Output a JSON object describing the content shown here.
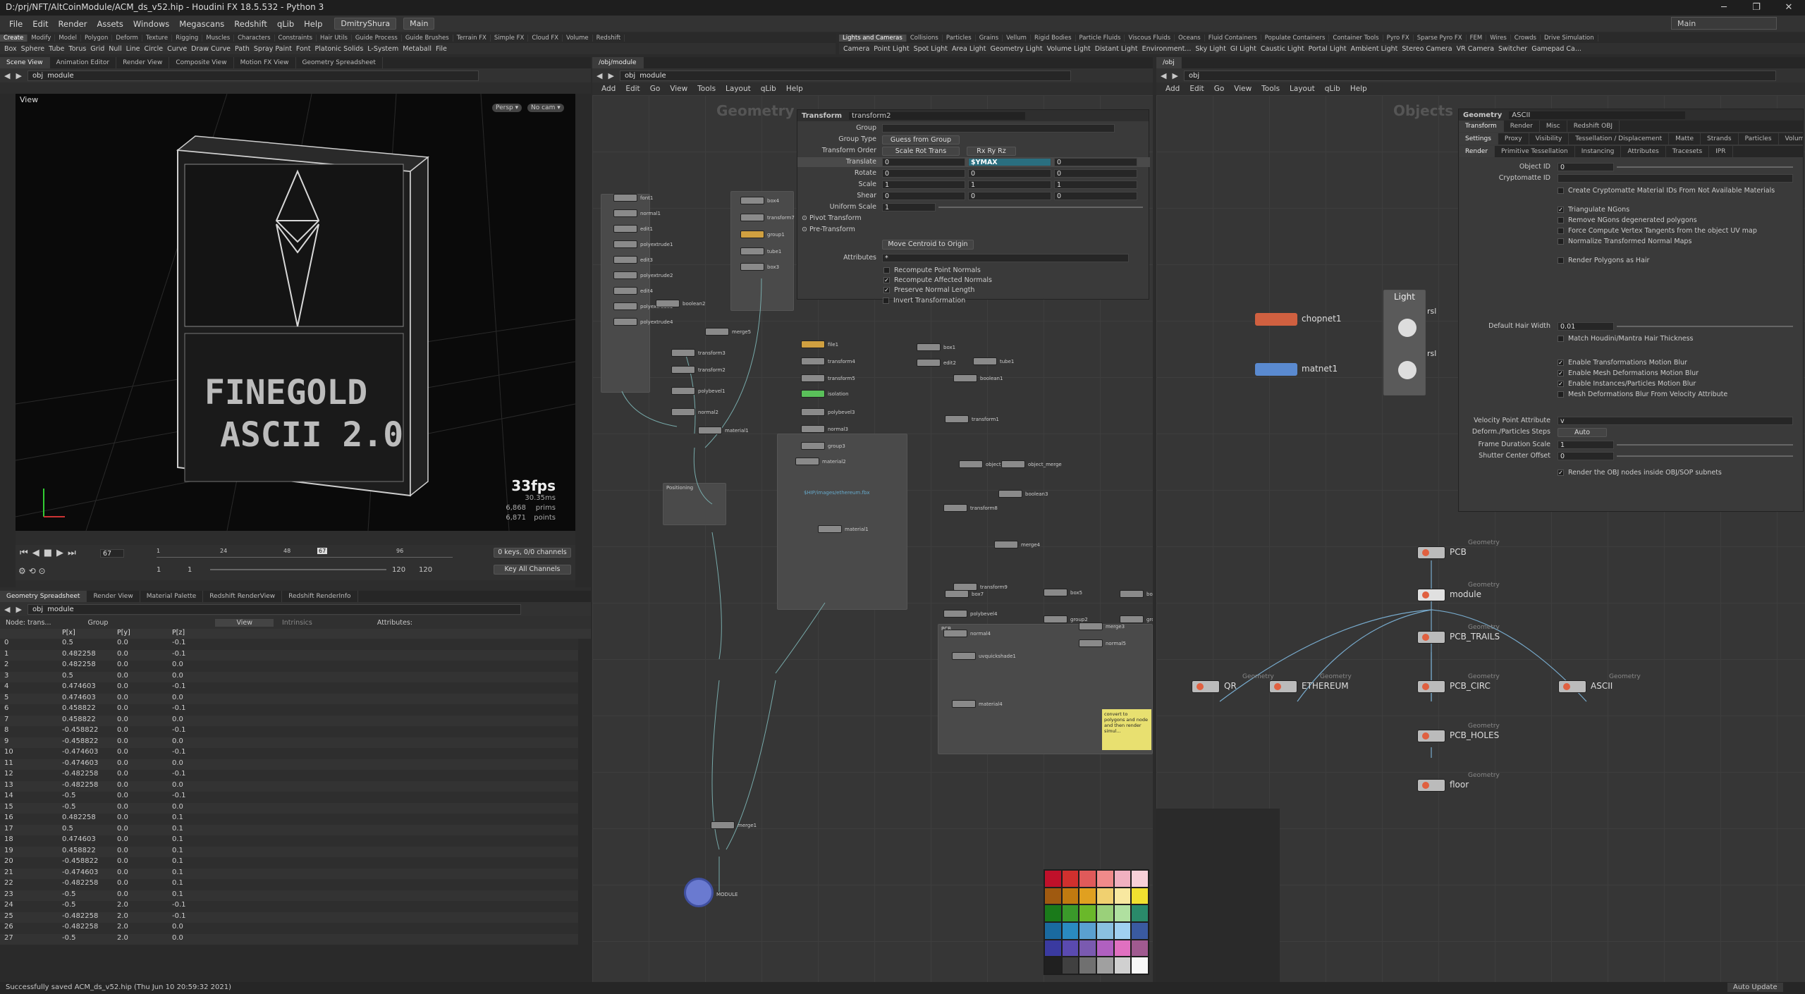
{
  "window": {
    "title": "D:/prj/NFT/AltCoinModule/ACM_ds_v52.hip - Houdini FX 18.5.532 - Python 3",
    "btn_min": "─",
    "btn_max": "❐",
    "btn_close": "✕"
  },
  "menu": {
    "items": [
      "File",
      "Edit",
      "Render",
      "Assets",
      "Windows",
      "Megascans",
      "Redshift",
      "qLib",
      "Help"
    ],
    "user": "DmitryShura",
    "desktop": "Main",
    "right_desktop": "Main"
  },
  "shelf_left": {
    "tabs": [
      "Create",
      "Modify",
      "Model",
      "Polygon",
      "Deform",
      "Texture",
      "Rigging",
      "Muscles",
      "Characters",
      "Constraints",
      "Hair Utils",
      "Guide Process",
      "Guide Brushes",
      "Terrain FX",
      "Simple FX",
      "Cloud FX",
      "Volume",
      "Redshift"
    ],
    "tools": [
      "Box",
      "Sphere",
      "Tube",
      "Torus",
      "Grid",
      "Null",
      "Line",
      "Circle",
      "Curve",
      "Draw Curve",
      "Path",
      "Spray Paint",
      "Font",
      "Platonic Solids",
      "L-System",
      "Metaball",
      "File"
    ]
  },
  "shelf_right": {
    "tabs": [
      "Lights and Cameras",
      "Collisions",
      "Particles",
      "Grains",
      "Vellum",
      "Rigid Bodies",
      "Particle Fluids",
      "Viscous Fluids",
      "Oceans",
      "Fluid Containers",
      "Populate Containers",
      "Container Tools",
      "Pyro FX",
      "Sparse Pyro FX",
      "FEM",
      "Wires",
      "Crowds",
      "Drive Simulation"
    ],
    "tools": [
      "Camera",
      "Point Light",
      "Spot Light",
      "Area Light",
      "Geometry Light",
      "Volume Light",
      "Distant Light",
      "Environment...",
      "Sky Light",
      "GI Light",
      "Caustic Light",
      "Portal Light",
      "Ambient Light",
      "Stereo Camera",
      "VR Camera",
      "Switcher",
      "Gamepad Ca..."
    ]
  },
  "viewport_pane": {
    "tabs": [
      "Scene View",
      "Animation Editor",
      "Render View",
      "Composite View",
      "Motion FX View",
      "Geometry Spreadsheet"
    ],
    "path_root": "obj",
    "path_node": "module",
    "label": "View",
    "persp": "Persp ▾",
    "cam": "No cam ▾",
    "fps": "33fps",
    "ms": "30.35ms",
    "prims_n": "6,868",
    "prims_l": "prims",
    "points_n": "6,871",
    "points_l": "points",
    "neon_text_1": "FINEGOLD",
    "neon_text_2": "ASCII 2.0"
  },
  "timeline": {
    "frame": "67",
    "ticks": [
      "1",
      "24",
      "48",
      "67",
      "96"
    ],
    "start": "1",
    "start2": "1",
    "end": "120",
    "end2": "120",
    "keys": "0 keys, 0/0 channels",
    "key_all": "Key All Channels"
  },
  "spreadsheet": {
    "tabs": [
      "Geometry Spreadsheet",
      "Render View",
      "Material Palette",
      "Redshift RenderView",
      "Redshift RenderInfo"
    ],
    "path_root": "obj",
    "path_node": "module",
    "node_label": "Node: trans...",
    "group_label": "Group",
    "view_label": "View",
    "intrinsics": "Intrinsics",
    "attributes": "Attributes:",
    "headers": [
      "",
      "P[x]",
      "P[y]",
      "P[z]"
    ],
    "rows": [
      [
        "0",
        "0.5",
        "0.0",
        "-0.1"
      ],
      [
        "1",
        "0.482258",
        "0.0",
        "-0.1"
      ],
      [
        "2",
        "0.482258",
        "0.0",
        "0.0"
      ],
      [
        "3",
        "0.5",
        "0.0",
        "0.0"
      ],
      [
        "4",
        "0.474603",
        "0.0",
        "-0.1"
      ],
      [
        "5",
        "0.474603",
        "0.0",
        "0.0"
      ],
      [
        "6",
        "0.458822",
        "0.0",
        "-0.1"
      ],
      [
        "7",
        "0.458822",
        "0.0",
        "0.0"
      ],
      [
        "8",
        "-0.458822",
        "0.0",
        "-0.1"
      ],
      [
        "9",
        "-0.458822",
        "0.0",
        "0.0"
      ],
      [
        "10",
        "-0.474603",
        "0.0",
        "-0.1"
      ],
      [
        "11",
        "-0.474603",
        "0.0",
        "0.0"
      ],
      [
        "12",
        "-0.482258",
        "0.0",
        "-0.1"
      ],
      [
        "13",
        "-0.482258",
        "0.0",
        "0.0"
      ],
      [
        "14",
        "-0.5",
        "0.0",
        "-0.1"
      ],
      [
        "15",
        "-0.5",
        "0.0",
        "0.0"
      ],
      [
        "16",
        "0.482258",
        "0.0",
        "0.1"
      ],
      [
        "17",
        "0.5",
        "0.0",
        "0.1"
      ],
      [
        "18",
        "0.474603",
        "0.0",
        "0.1"
      ],
      [
        "19",
        "0.458822",
        "0.0",
        "0.1"
      ],
      [
        "20",
        "-0.458822",
        "0.0",
        "0.1"
      ],
      [
        "21",
        "-0.474603",
        "0.0",
        "0.1"
      ],
      [
        "22",
        "-0.482258",
        "0.0",
        "0.1"
      ],
      [
        "23",
        "-0.5",
        "0.0",
        "0.1"
      ],
      [
        "24",
        "-0.5",
        "2.0",
        "-0.1"
      ],
      [
        "25",
        "-0.482258",
        "2.0",
        "-0.1"
      ],
      [
        "26",
        "-0.482258",
        "2.0",
        "0.0"
      ],
      [
        "27",
        "-0.5",
        "2.0",
        "0.0"
      ]
    ]
  },
  "status": {
    "text": "Successfully saved ACM_ds_v52.hip (Thu Jun 10 20:59:32 2021)",
    "auto_update": "Auto Update"
  },
  "sop_net": {
    "tab": "/obj/module",
    "path_root": "obj",
    "path_node": "module",
    "menu": [
      "Add",
      "Edit",
      "Go",
      "View",
      "Tools",
      "Layout",
      "qLib",
      "Help"
    ],
    "context": "Geometry",
    "nodes": [
      {
        "t": "font1"
      },
      {
        "t": "normal1"
      },
      {
        "t": "edit1"
      },
      {
        "t": "polyextrude1"
      },
      {
        "t": "edit3"
      },
      {
        "t": "polyextrude2"
      },
      {
        "t": "edit4"
      },
      {
        "t": "polyextrude3"
      },
      {
        "t": "polyextrude4"
      },
      {
        "t": "box4"
      },
      {
        "t": "transform7"
      },
      {
        "t": "group1"
      },
      {
        "t": "tube1"
      },
      {
        "t": "box3"
      },
      {
        "t": "boolean2"
      },
      {
        "t": "merge5"
      },
      {
        "t": "transform3"
      },
      {
        "t": "transform2"
      },
      {
        "t": "polybevel1"
      },
      {
        "t": "normal2"
      },
      {
        "t": "material1"
      },
      {
        "t": "file1"
      },
      {
        "t": "transform4"
      },
      {
        "t": "transform5"
      },
      {
        "t": "isolation"
      },
      {
        "t": "polybevel3"
      },
      {
        "t": "normal3"
      },
      {
        "t": "group3"
      },
      {
        "t": "material2"
      },
      {
        "t": "merge1"
      },
      {
        "t": "MODULE"
      },
      {
        "t": "box1"
      },
      {
        "t": "edit2"
      },
      {
        "t": "tube1"
      },
      {
        "t": "boolean1"
      },
      {
        "t": "transform1"
      },
      {
        "t": "object_merge4"
      },
      {
        "t": "object_merge"
      },
      {
        "t": "transform8"
      },
      {
        "t": "boolean3"
      },
      {
        "t": "merge4"
      },
      {
        "t": "transform9"
      },
      {
        "t": "box7"
      },
      {
        "t": "polybevel4"
      },
      {
        "t": "normal4"
      },
      {
        "t": "uvquickshade1"
      },
      {
        "t": "material4"
      },
      {
        "t": "box5"
      },
      {
        "t": "group2"
      },
      {
        "t": "box6"
      },
      {
        "t": "group4"
      },
      {
        "t": "merge3"
      },
      {
        "t": "normal5"
      },
      {
        "t": "material1"
      }
    ],
    "positioning_label": "Positioning",
    "pcb_label": "PCB",
    "sticky": "convert to polygons and node and then render simul...",
    "file_sub": "$HIP/images/ethereum.fbx"
  },
  "transform_params": {
    "type_label": "Transform",
    "node_name": "transform2",
    "rows": {
      "group": "Group",
      "group_type": "Group Type",
      "group_type_val": "Guess from Group",
      "xform_order": "Transform Order",
      "xform_order_val": "Scale Rot Trans",
      "rot_order_val": "Rx Ry Rz",
      "translate": "Translate",
      "rotate": "Rotate",
      "scale": "Scale",
      "shear": "Shear",
      "uniform_scale": "Uniform Scale",
      "pivot": "Pivot Transform",
      "pre": "Pre-Transform",
      "move_centroid": "Move Centroid to Origin",
      "attributes": "Attributes",
      "attr_val": "*",
      "recompute_point": "Recompute Point Normals",
      "recompute_affected": "Recompute Affected Normals",
      "preserve": "Preserve Normal Length",
      "invert": "Invert Transformation"
    },
    "translate": [
      "0",
      "$YMAX",
      "0"
    ],
    "rotate": [
      "0",
      "0",
      "0"
    ],
    "scale": [
      "1",
      "1",
      "1"
    ],
    "shear": [
      "0",
      "0",
      "0"
    ],
    "uniform": "1"
  },
  "obj_net": {
    "tab": "/obj",
    "path_root": "obj",
    "menu": [
      "Add",
      "Edit",
      "Go",
      "View",
      "Tools",
      "Layout",
      "qLib",
      "Help"
    ],
    "context": "Objects",
    "chopnet": "chopnet1",
    "matnet": "matnet1",
    "light_box": "Light",
    "rs1": "rsl",
    "rs2": "rsl",
    "geo_cap": "Geometry",
    "nodes": [
      "PCB",
      "module",
      "PCB_TRAILS",
      "QR",
      "ETHEREUM",
      "PCB_CIRC",
      "ASCII",
      "PCB_HOLES",
      "floor"
    ]
  },
  "geo_params": {
    "type_label": "Geometry",
    "node_name": "ASCII",
    "tabs": [
      "Transform",
      "Render",
      "Misc",
      "Redshift OBJ"
    ],
    "subtabs": [
      "Settings",
      "Proxy",
      "Visibility",
      "Tessellation / Displacement",
      "Matte",
      "Strands",
      "Particles",
      "Volume"
    ],
    "subtabs2": [
      "Render",
      "Primitive Tessellation",
      "Instancing",
      "Attributes",
      "Tracesets",
      "IPR"
    ],
    "object_id": "Object ID",
    "object_id_val": "0",
    "crypto": "Cryptomatte ID",
    "checks": [
      {
        "label": "Create Cryptomatte Material IDs From Not Available Materials",
        "on": false
      },
      {
        "label": "Triangulate NGons",
        "on": true
      },
      {
        "label": "Remove NGons degenerated polygons",
        "on": false
      },
      {
        "label": "Force Compute Vertex Tangents from the object UV map",
        "on": false
      },
      {
        "label": "Normalize Transformed Normal Maps",
        "on": false
      },
      {
        "label": "Render Polygons as Hair",
        "on": false
      }
    ],
    "hair_width": "Default Hair Width",
    "hair_val": "0.01",
    "match_hair": "Match Houdini/Mantra Hair Thickness",
    "blur_checks": [
      {
        "label": "Enable Transformations Motion Blur",
        "on": true
      },
      {
        "label": "Enable Mesh Deformations Motion Blur",
        "on": true
      },
      {
        "label": "Enable Instances/Particles Motion Blur",
        "on": true
      },
      {
        "label": "Mesh Deformations Blur From Velocity Attribute",
        "on": false
      }
    ],
    "vel_attr": "Velocity Point Attribute",
    "vel_val": "v",
    "deform_steps": "Deform./Particles Steps",
    "deform_val": "Auto",
    "frame_dur": "Frame Duration Scale",
    "frame_val": "1",
    "shutter": "Shutter Center Offset",
    "shutter_val": "0",
    "render_obj": "Render the OBJ nodes inside OBJ/SOP subnets",
    "colors": {
      "accent": "#f0a030",
      "selected": "#2a6f80"
    }
  },
  "palette": {
    "colors": [
      "#c0102a",
      "#d0302e",
      "#e05a5a",
      "#f08a8a",
      "#f0b0c0",
      "#f8d0d8",
      "#a05a10",
      "#c07a10",
      "#e0a020",
      "#f0d070",
      "#f8e8a0",
      "#f0e030",
      "#1a7a1a",
      "#3a9a2a",
      "#6ab82a",
      "#9ad07a",
      "#b0e0a0",
      "#2a8a6a",
      "#1a6aa0",
      "#2a8ac0",
      "#5aa0d0",
      "#8ac0e0",
      "#a0d0f0",
      "#3a5aa0",
      "#3a3aa0",
      "#5a4ab0",
      "#7a5ab0",
      "#b060c0",
      "#e070c0",
      "#a05a90",
      "#202020",
      "#404040",
      "#707070",
      "#a0a0a0",
      "#d0d0d0",
      "#f8f8f8"
    ]
  }
}
